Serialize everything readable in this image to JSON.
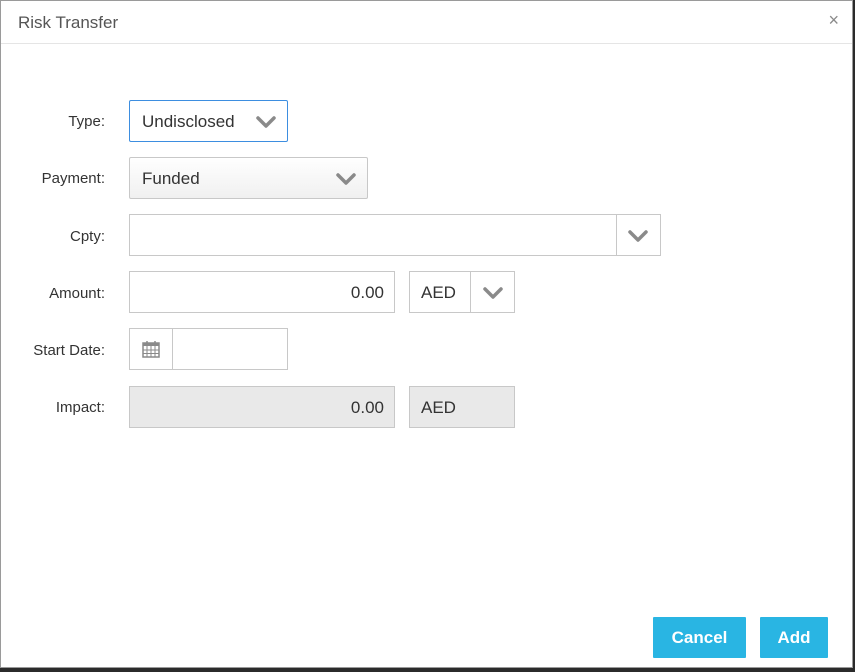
{
  "dialog": {
    "title": "Risk Transfer",
    "close_glyph": "×"
  },
  "form": {
    "type": {
      "label": "Type:",
      "value": "Undisclosed"
    },
    "payment": {
      "label": "Payment:",
      "value": "Funded"
    },
    "cpty": {
      "label": "Cpty:",
      "value": ""
    },
    "amount": {
      "label": "Amount:",
      "value": "0.00",
      "currency": "AED"
    },
    "start_date": {
      "label": "Start Date:",
      "value": ""
    },
    "impact": {
      "label": "Impact:",
      "value": "0.00",
      "currency": "AED"
    }
  },
  "buttons": {
    "cancel": "Cancel",
    "add": "Add"
  },
  "colors": {
    "accent": "#29b5e3",
    "focus_border": "#3d8ee0",
    "disabled_bg": "#e9e9e9"
  }
}
